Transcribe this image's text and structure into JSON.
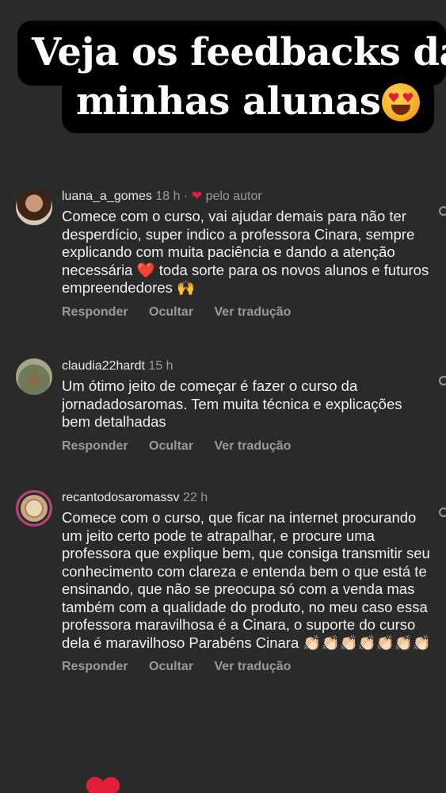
{
  "header": {
    "line1": "Veja os feedbacks da",
    "line2": "minhas alunas",
    "emoji": "heart-eyes-emoji"
  },
  "comments": [
    {
      "username": "luana_a_gomes",
      "time": "18 h",
      "separator": "·",
      "liked_by_author": "pelo autor",
      "text_part1": "Comece com o curso, vai ajudar demais para não ter desperdício, super indico a professora Cinara, sempre explicando com muita paciência e dando a atenção necessária",
      "text_part2": "toda sorte para os novos alunos e futuros empreendedores",
      "emojis": [
        "red-heart",
        "raising-hands"
      ],
      "reply": "Responder",
      "hide": "Ocultar",
      "translate": "Ver tradução"
    },
    {
      "username": "claudia22hardt",
      "time": "15 h",
      "text": "Um ótimo jeito de começar é fazer o curso da jornadadosaromas. Tem muita técnica e explicações bem detalhadas",
      "reply": "Responder",
      "hide": "Ocultar",
      "translate": "Ver tradução"
    },
    {
      "username": "recantodosaromassv",
      "time": "22 h",
      "text": "Comece com o curso, que ficar na internet procurando um jeito certo pode te atrapalhar, e procure uma professora que explique bem, que consiga transmitir seu conhecimento com clareza e entenda bem o que está te ensinando, que não se preocupa só com a venda mas também com a qualidade do produto, no meu caso essa professora maravilhosa é a Cinara, o suporte do curso dela é maravilhoso Parabéns Cinara",
      "emoji_trail": "👏🏻👏🏻👏🏻👏🏻👏🏻👏🏻👏🏻",
      "reply": "Responder",
      "hide": "Ocultar",
      "translate": "Ver tradução"
    }
  ],
  "colors": {
    "background": "#2a2a2a",
    "banner": "#000000",
    "heart": "#e0203a",
    "muted": "#9a9a9a"
  }
}
